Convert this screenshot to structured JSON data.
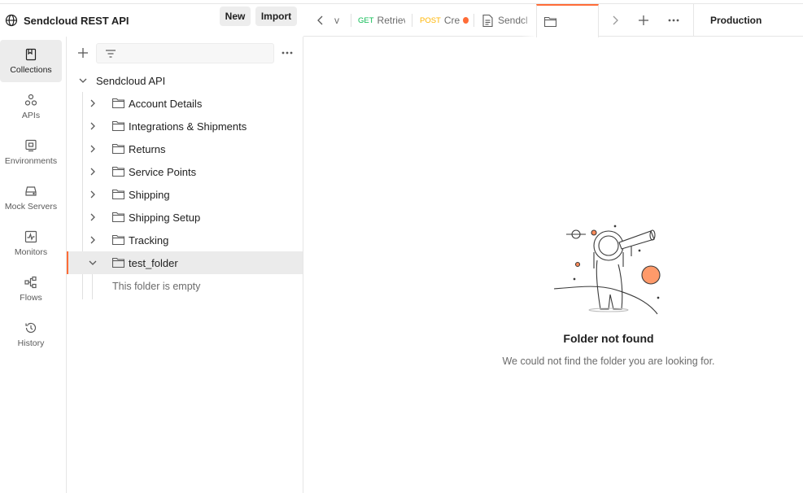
{
  "workspace": {
    "title": "Sendcloud REST API",
    "new_label": "New",
    "import_label": "Import"
  },
  "rail": {
    "items": [
      {
        "label": "Collections",
        "icon": "collections-icon",
        "active": true
      },
      {
        "label": "APIs",
        "icon": "apis-icon",
        "active": false
      },
      {
        "label": "Environments",
        "icon": "environments-icon",
        "active": false
      },
      {
        "label": "Mock Servers",
        "icon": "mock-servers-icon",
        "active": false
      },
      {
        "label": "Monitors",
        "icon": "monitors-icon",
        "active": false
      },
      {
        "label": "Flows",
        "icon": "flows-icon",
        "active": false
      },
      {
        "label": "History",
        "icon": "history-icon",
        "active": false
      }
    ]
  },
  "sidebar": {
    "search_placeholder": "",
    "collection": {
      "name": "Sendcloud API",
      "folders": [
        {
          "name": "Account Details",
          "expanded": false
        },
        {
          "name": "Integrations & Shipments",
          "expanded": false
        },
        {
          "name": "Returns",
          "expanded": false
        },
        {
          "name": "Service Points",
          "expanded": false
        },
        {
          "name": "Shipping",
          "expanded": false
        },
        {
          "name": "Shipping Setup",
          "expanded": false
        },
        {
          "name": "Tracking",
          "expanded": false
        },
        {
          "name": "test_folder",
          "expanded": true,
          "selected": true
        }
      ],
      "empty_folder_text": "This folder is empty"
    }
  },
  "tabs": {
    "items": [
      {
        "method": "",
        "name": "v"
      },
      {
        "method": "GET",
        "name": "Retriev"
      },
      {
        "method": "POST",
        "name": "Cre",
        "unsaved": true
      },
      {
        "method": "",
        "name": "Sendcl",
        "icon": "document-icon"
      },
      {
        "method": "",
        "name": "",
        "icon": "folder-icon",
        "active": true
      }
    ],
    "environment": "Production"
  },
  "main": {
    "title": "Folder not found",
    "subtitle": "We could not find the folder you are looking for."
  },
  "colors": {
    "accent": "#ff6c37",
    "get": "#0cbb52",
    "post": "#ffb400"
  }
}
